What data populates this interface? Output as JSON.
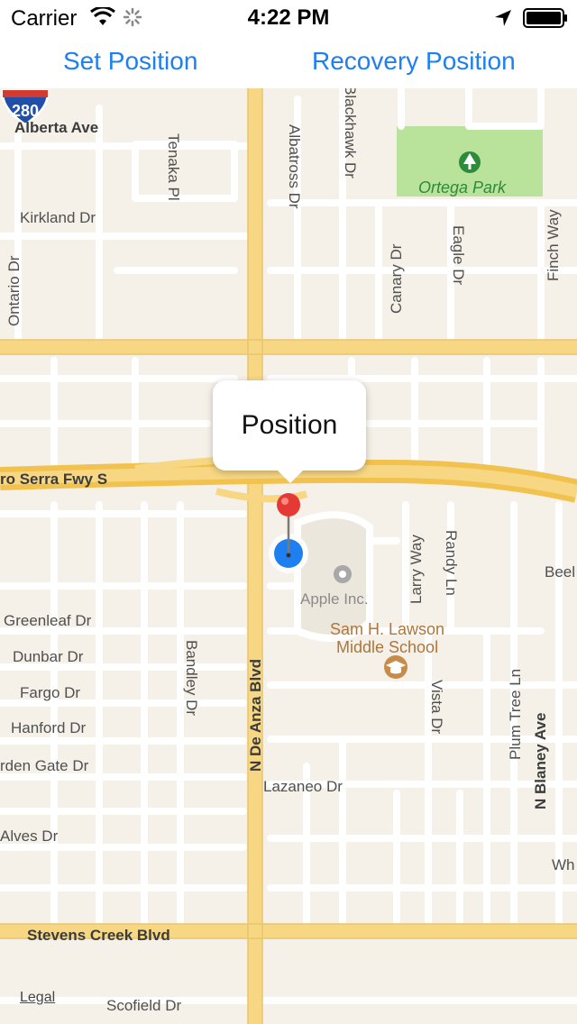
{
  "status": {
    "carrier": "Carrier",
    "time": "4:22 PM"
  },
  "toolbar": {
    "set_label": "Set Position",
    "recovery_label": "Recovery Position"
  },
  "map": {
    "callout_title": "Position",
    "legal": "Legal",
    "highway_shield": "280",
    "park": "Ortega Park",
    "school_line1": "Sam H. Lawson",
    "school_line2": "Middle School",
    "poi_apple": "Apple Inc.",
    "streets": {
      "alberta": "Alberta Ave",
      "kirkland": "Kirkland Dr",
      "tenaka": "Tenaka Pl",
      "albatross": "Albatross Dr",
      "blackhawk": "Blackhawk Dr",
      "ontario": "Ontario Dr",
      "canary": "Canary Dr",
      "eagle": "Eagle Dr",
      "finch": "Finch Way",
      "freeway": "ro Serra Fwy S",
      "greenleaf": "Greenleaf Dr",
      "dunbar": "Dunbar Dr",
      "fargo": "Fargo Dr",
      "hanford": "Hanford Dr",
      "golden_gate": "rden Gate Dr",
      "alves": "Alves Dr",
      "bandley": "Bandley Dr",
      "de_anza": "N De Anza Blvd",
      "larry": "Larry Way",
      "randy": "Randy Ln",
      "vista": "Vista Dr",
      "plum_tree": "Plum Tree Ln",
      "blaney": "N Blaney Ave",
      "lazaneo": "Lazaneo Dr",
      "stevens": "Stevens Creek Blvd",
      "scofield": "Scofield Dr",
      "beel": "Beel",
      "wh": "Wh"
    }
  },
  "colors": {
    "accent": "#1e7ff0",
    "pin": "#e53935",
    "user_dot": "#1e7ff0",
    "major_road": "#f7d783",
    "park": "#b9e29a"
  }
}
